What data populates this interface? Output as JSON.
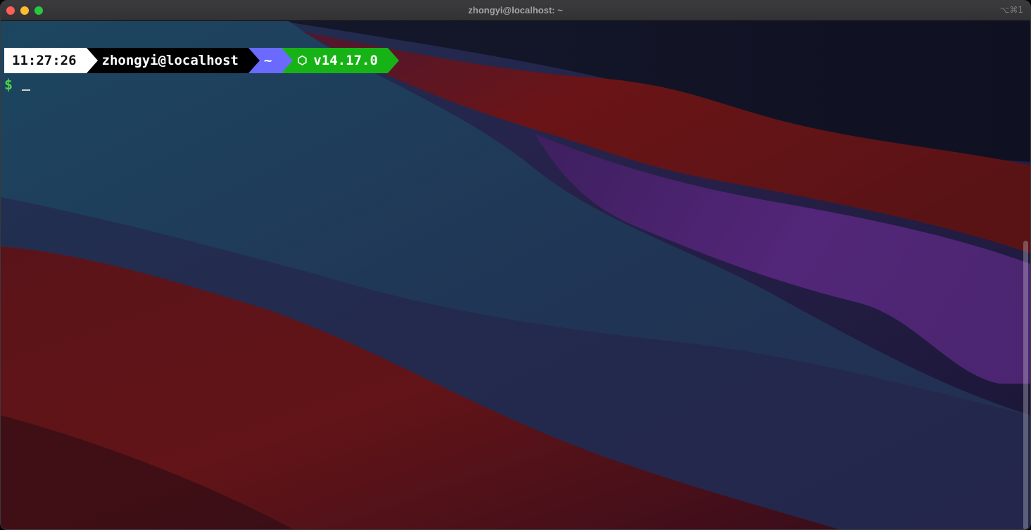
{
  "window": {
    "title": "zhongyi@localhost: ~",
    "shortcut": "⌥⌘1"
  },
  "prompt": {
    "time": "11:27:26",
    "user_host": "zhongyi@localhost",
    "directory": "~",
    "node_icon": "⬡",
    "node_version": "v14.17.0",
    "symbol": "$"
  },
  "colors": {
    "time_bg": "#ffffff",
    "user_bg": "#000000",
    "dir_bg": "#6a6aff",
    "node_bg": "#17b316",
    "dollar": "#4cd64b"
  }
}
